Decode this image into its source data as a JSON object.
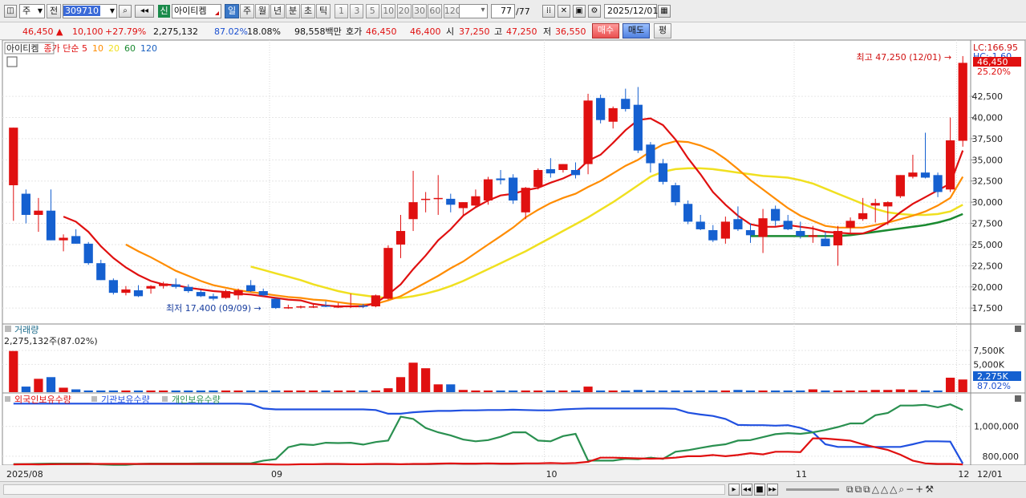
{
  "toolbar": {
    "type_select": "주",
    "prev_label": "전",
    "code": "309710",
    "new_badge": "신",
    "stock_name": "아이티켐",
    "periods": [
      "일",
      "주",
      "월",
      "년",
      "분",
      "초",
      "틱"
    ],
    "active_period": "일",
    "intervals": [
      "1",
      "3",
      "5",
      "10",
      "20",
      "30",
      "60",
      "120"
    ],
    "count": "77",
    "count_total": "/77",
    "date": "2025/12/01"
  },
  "quote": {
    "price": "46,450",
    "change_arrow": "▲",
    "change": "10,100",
    "change_pct": "+27.79%",
    "volume": "2,275,132",
    "vol_ratio": "87.02%",
    "turnover": "18.08%",
    "amount": "98,558백만",
    "bid_label": "호가",
    "ask": "46,450",
    "bid": "46,400",
    "open_label": "시",
    "open": "37,250",
    "high_label": "고",
    "high": "47,250",
    "low_label": "저",
    "low": "36,550",
    "buy_label": "매수",
    "sell_label": "매도",
    "flat_label": "평"
  },
  "price_pane": {
    "legend_name": "아이티켐",
    "legend_ma": "종가 단순",
    "ma_periods": [
      "5",
      "10",
      "20",
      "60",
      "120"
    ],
    "lc": "LC:166.95",
    "hc": "HC:-1.60",
    "current_tag": "46,450",
    "current_pct": "25.20%",
    "high_note": "최고 47,250 (12/01)",
    "low_note": "최저 17,400 (09/09)",
    "y_ticks": [
      "42,500",
      "40,000",
      "37,500",
      "35,000",
      "32,500",
      "30,000",
      "27,500",
      "25,000",
      "22,500",
      "20,000",
      "17,500"
    ]
  },
  "volume_pane": {
    "title": "거래량",
    "value_text": "2,275,132주(87.02%)",
    "y_ticks": [
      "7,500K",
      "5,000K"
    ],
    "current_tag": "2,275K",
    "current_pct": "87.02%"
  },
  "holding_pane": {
    "legend": [
      "외국인보유수량",
      "기관보유수량",
      "개인보유수량"
    ],
    "y_ticks": [
      "1,000,000",
      "800,000"
    ]
  },
  "x_axis": {
    "labels": [
      "2025/08",
      "09",
      "10",
      "11",
      "12"
    ],
    "right_label": "12/01"
  },
  "colors": {
    "up": "#e01010",
    "down": "#1560d0",
    "ma5": "#e01010",
    "ma10": "#ff8c00",
    "ma20": "#f0e020",
    "ma60": "#1a8a30",
    "foreign": "#e01010",
    "institution": "#2050e0",
    "individual": "#2a9050"
  },
  "chart_data": {
    "type": "candlestick",
    "x_start": "2025/08",
    "x_end": "2025/12/01",
    "ylim": [
      16000,
      48000
    ],
    "candles": [
      {
        "o": 32000,
        "h": 38800,
        "l": 27800,
        "c": 38800
      },
      {
        "o": 31000,
        "h": 31500,
        "l": 27500,
        "c": 28500
      },
      {
        "o": 28500,
        "h": 30500,
        "l": 26500,
        "c": 29000
      },
      {
        "o": 29000,
        "h": 31500,
        "l": 25500,
        "c": 25500
      },
      {
        "o": 25500,
        "h": 26200,
        "l": 24200,
        "c": 25800
      },
      {
        "o": 26000,
        "h": 26800,
        "l": 25100,
        "c": 25100
      },
      {
        "o": 25100,
        "h": 25300,
        "l": 22600,
        "c": 22800
      },
      {
        "o": 22800,
        "h": 23200,
        "l": 20800,
        "c": 20800
      },
      {
        "o": 20800,
        "h": 21000,
        "l": 19100,
        "c": 19300
      },
      {
        "o": 19300,
        "h": 20100,
        "l": 19000,
        "c": 19700
      },
      {
        "o": 19600,
        "h": 20200,
        "l": 18800,
        "c": 18900
      },
      {
        "o": 19800,
        "h": 20200,
        "l": 19200,
        "c": 20100
      },
      {
        "o": 20100,
        "h": 20600,
        "l": 19800,
        "c": 20400
      },
      {
        "o": 20300,
        "h": 21000,
        "l": 19800,
        "c": 20000
      },
      {
        "o": 20000,
        "h": 20300,
        "l": 19300,
        "c": 19500
      },
      {
        "o": 19400,
        "h": 19600,
        "l": 18800,
        "c": 18900
      },
      {
        "o": 18900,
        "h": 19200,
        "l": 18400,
        "c": 18600
      },
      {
        "o": 18700,
        "h": 19700,
        "l": 18600,
        "c": 19500
      },
      {
        "o": 19000,
        "h": 19800,
        "l": 18500,
        "c": 19600
      },
      {
        "o": 20200,
        "h": 20800,
        "l": 19400,
        "c": 19500
      },
      {
        "o": 19500,
        "h": 19800,
        "l": 18900,
        "c": 19000
      },
      {
        "o": 18600,
        "h": 18700,
        "l": 17400,
        "c": 17500
      },
      {
        "o": 17500,
        "h": 17900,
        "l": 17400,
        "c": 17600
      },
      {
        "o": 17600,
        "h": 17800,
        "l": 17450,
        "c": 17700
      },
      {
        "o": 17600,
        "h": 18000,
        "l": 17500,
        "c": 17700
      },
      {
        "o": 17800,
        "h": 18300,
        "l": 17600,
        "c": 17700
      },
      {
        "o": 17700,
        "h": 18100,
        "l": 17500,
        "c": 17700
      },
      {
        "o": 17700,
        "h": 19200,
        "l": 17500,
        "c": 17800
      },
      {
        "o": 17800,
        "h": 18000,
        "l": 17500,
        "c": 17700
      },
      {
        "o": 17700,
        "h": 19100,
        "l": 17600,
        "c": 19000
      },
      {
        "o": 18600,
        "h": 24900,
        "l": 18500,
        "c": 24600
      },
      {
        "o": 25000,
        "h": 28500,
        "l": 23400,
        "c": 26600
      },
      {
        "o": 28000,
        "h": 33700,
        "l": 26600,
        "c": 30000
      },
      {
        "o": 30300,
        "h": 31200,
        "l": 28800,
        "c": 30400
      },
      {
        "o": 30400,
        "h": 33200,
        "l": 28500,
        "c": 30500
      },
      {
        "o": 30400,
        "h": 31000,
        "l": 28800,
        "c": 29700
      },
      {
        "o": 29300,
        "h": 30000,
        "l": 28400,
        "c": 30000
      },
      {
        "o": 29600,
        "h": 31500,
        "l": 29400,
        "c": 30700
      },
      {
        "o": 30200,
        "h": 33000,
        "l": 29700,
        "c": 32700
      },
      {
        "o": 32800,
        "h": 33800,
        "l": 32100,
        "c": 32600
      },
      {
        "o": 32900,
        "h": 33300,
        "l": 29800,
        "c": 30200
      },
      {
        "o": 28800,
        "h": 31800,
        "l": 28000,
        "c": 31700
      },
      {
        "o": 31800,
        "h": 34000,
        "l": 31500,
        "c": 33800
      },
      {
        "o": 33900,
        "h": 35200,
        "l": 32900,
        "c": 33400
      },
      {
        "o": 33800,
        "h": 34500,
        "l": 33500,
        "c": 34500
      },
      {
        "o": 33800,
        "h": 34700,
        "l": 32800,
        "c": 33200
      },
      {
        "o": 34500,
        "h": 42800,
        "l": 33300,
        "c": 42000
      },
      {
        "o": 42300,
        "h": 42700,
        "l": 39300,
        "c": 39700
      },
      {
        "o": 39500,
        "h": 41300,
        "l": 38700,
        "c": 41100
      },
      {
        "o": 42200,
        "h": 43400,
        "l": 40700,
        "c": 41000
      },
      {
        "o": 41500,
        "h": 43600,
        "l": 35800,
        "c": 36100
      },
      {
        "o": 36800,
        "h": 37100,
        "l": 33500,
        "c": 34600
      },
      {
        "o": 34600,
        "h": 35100,
        "l": 32100,
        "c": 32400
      },
      {
        "o": 32000,
        "h": 32300,
        "l": 29600,
        "c": 30000
      },
      {
        "o": 29800,
        "h": 30200,
        "l": 27400,
        "c": 27700
      },
      {
        "o": 27700,
        "h": 28500,
        "l": 26700,
        "c": 26800
      },
      {
        "o": 26700,
        "h": 27300,
        "l": 25300,
        "c": 25500
      },
      {
        "o": 25700,
        "h": 28300,
        "l": 25100,
        "c": 27700
      },
      {
        "o": 28000,
        "h": 29500,
        "l": 26600,
        "c": 26800
      },
      {
        "o": 26700,
        "h": 27500,
        "l": 25200,
        "c": 26100
      },
      {
        "o": 25900,
        "h": 29200,
        "l": 24000,
        "c": 28100
      },
      {
        "o": 29200,
        "h": 29600,
        "l": 27200,
        "c": 27800
      },
      {
        "o": 27800,
        "h": 28500,
        "l": 26700,
        "c": 26800
      },
      {
        "o": 26600,
        "h": 27700,
        "l": 25700,
        "c": 26000
      },
      {
        "o": 25900,
        "h": 27200,
        "l": 25200,
        "c": 26100
      },
      {
        "o": 25700,
        "h": 26500,
        "l": 24800,
        "c": 24800
      },
      {
        "o": 24900,
        "h": 27200,
        "l": 22500,
        "c": 26600
      },
      {
        "o": 27000,
        "h": 28200,
        "l": 26400,
        "c": 27800
      },
      {
        "o": 28000,
        "h": 30500,
        "l": 27800,
        "c": 28700
      },
      {
        "o": 29600,
        "h": 30400,
        "l": 27600,
        "c": 29900
      },
      {
        "o": 29500,
        "h": 30100,
        "l": 27300,
        "c": 30000
      },
      {
        "o": 30700,
        "h": 33200,
        "l": 30500,
        "c": 33200
      },
      {
        "o": 33000,
        "h": 35600,
        "l": 32800,
        "c": 33500
      },
      {
        "o": 33500,
        "h": 38200,
        "l": 32800,
        "c": 32900
      },
      {
        "o": 33200,
        "h": 33500,
        "l": 30600,
        "c": 31200
      },
      {
        "o": 31500,
        "h": 40000,
        "l": 31200,
        "c": 37300
      },
      {
        "o": 37250,
        "h": 47250,
        "l": 36550,
        "c": 46450
      }
    ],
    "ma5": [
      null,
      null,
      null,
      null,
      28300,
      27700,
      26500,
      24800,
      23400,
      22300,
      21400,
      20700,
      20300,
      20200,
      19900,
      19700,
      19500,
      19400,
      19200,
      19100,
      18900,
      18700,
      18500,
      18400,
      18000,
      17800,
      17700,
      17700,
      17700,
      18100,
      19100,
      20300,
      22100,
      23700,
      25500,
      26800,
      28400,
      29400,
      30200,
      30800,
      31000,
      31400,
      31700,
      32300,
      32800,
      33500,
      34900,
      35600,
      37000,
      38500,
      39700,
      39900,
      39100,
      37400,
      35200,
      33300,
      31200,
      29700,
      28400,
      27400,
      27100,
      27100,
      27300,
      27100,
      26900,
      26500,
      26400,
      26300,
      26300,
      26800,
      27600,
      28800,
      29800,
      30600,
      31400,
      32200,
      36100
    ],
    "ma10": [
      null,
      null,
      null,
      null,
      null,
      null,
      null,
      null,
      null,
      25000,
      24200,
      23500,
      22700,
      21900,
      21300,
      20700,
      20200,
      19900,
      19600,
      19400,
      19200,
      19000,
      18800,
      18700,
      18500,
      18400,
      18200,
      18000,
      17900,
      18000,
      18400,
      18900,
      19700,
      20500,
      21300,
      22200,
      23000,
      24000,
      25000,
      26000,
      27000,
      28200,
      29100,
      29900,
      30500,
      31000,
      31800,
      32500,
      33400,
      34300,
      35000,
      36000,
      36800,
      37200,
      37100,
      36700,
      36100,
      35100,
      33900,
      32600,
      31500,
      30400,
      29300,
      28400,
      27800,
      27200,
      27000,
      27000,
      27000,
      27300,
      27600,
      28000,
      28400,
      28900,
      29600,
      30500,
      33000
    ],
    "ma20": [
      null,
      null,
      null,
      null,
      null,
      null,
      null,
      null,
      null,
      null,
      null,
      null,
      null,
      null,
      null,
      null,
      null,
      null,
      null,
      22400,
      22000,
      21600,
      21200,
      20800,
      20300,
      19900,
      19500,
      19200,
      19000,
      18800,
      18700,
      18700,
      18900,
      19200,
      19600,
      20100,
      20700,
      21400,
      22100,
      22800,
      23500,
      24200,
      25000,
      25800,
      26600,
      27400,
      28200,
      29100,
      30000,
      31000,
      32000,
      33000,
      33600,
      33900,
      34000,
      34000,
      33900,
      33700,
      33500,
      33300,
      33100,
      33000,
      32900,
      32600,
      32200,
      31600,
      31000,
      30400,
      29800,
      29200,
      28800,
      28600,
      28500,
      28500,
      28600,
      28900,
      29700
    ],
    "ma60": [
      null,
      null,
      null,
      null,
      null,
      null,
      null,
      null,
      null,
      null,
      null,
      null,
      null,
      null,
      null,
      null,
      null,
      null,
      null,
      null,
      null,
      null,
      null,
      null,
      null,
      null,
      null,
      null,
      null,
      null,
      null,
      null,
      null,
      null,
      null,
      null,
      null,
      null,
      null,
      null,
      null,
      null,
      null,
      null,
      null,
      null,
      null,
      null,
      null,
      null,
      null,
      null,
      null,
      null,
      null,
      null,
      null,
      null,
      null,
      26000,
      26000,
      26000,
      26000,
      26000,
      26000,
      26000,
      26000,
      26100,
      26300,
      26500,
      26700,
      26900,
      27100,
      27300,
      27600,
      28000,
      28600
    ],
    "volume": [
      7400,
      1000,
      2400,
      2700,
      800,
      500,
      300,
      300,
      300,
      300,
      300,
      300,
      300,
      300,
      300,
      300,
      300,
      300,
      300,
      300,
      300,
      300,
      300,
      300,
      300,
      300,
      300,
      300,
      300,
      300,
      700,
      2700,
      5300,
      4300,
      1400,
      1400,
      400,
      300,
      300,
      300,
      300,
      300,
      300,
      300,
      300,
      300,
      1000,
      300,
      300,
      300,
      400,
      300,
      300,
      300,
      300,
      300,
      300,
      300,
      400,
      300,
      300,
      300,
      300,
      300,
      500,
      300,
      300,
      300,
      300,
      400,
      400,
      500,
      400,
      300,
      300,
      2600,
      2275
    ],
    "volume_ylim": [
      0,
      8800
    ],
    "foreign": [
      745000,
      746000,
      745000,
      746000,
      747000,
      747000,
      748000,
      748000,
      748000,
      748000,
      748000,
      748000,
      748000,
      748000,
      748000,
      748000,
      748000,
      748000,
      748000,
      748000,
      746000,
      744000,
      744000,
      746000,
      746000,
      748000,
      748000,
      746000,
      746000,
      748000,
      748000,
      746000,
      748000,
      748000,
      750000,
      752000,
      750000,
      750000,
      752000,
      750000,
      750000,
      752000,
      752000,
      754000,
      752000,
      754000,
      762000,
      790000,
      790000,
      788000,
      785000,
      783000,
      785000,
      790000,
      800000,
      800000,
      808000,
      800000,
      808000,
      820000,
      812000,
      830000,
      830000,
      828000,
      920000,
      918000,
      912000,
      905000,
      880000,
      860000,
      842000,
      810000,
      770000,
      752000,
      748000,
      748000,
      745000
    ],
    "institution": [
      1153000,
      1153000,
      1153000,
      1153000,
      1153000,
      1153000,
      1153000,
      1153000,
      1153000,
      1153000,
      1153000,
      1153000,
      1153000,
      1153000,
      1153000,
      1153000,
      1153000,
      1153000,
      1153000,
      1150000,
      1120000,
      1114000,
      1114000,
      1114000,
      1114000,
      1114000,
      1114000,
      1114000,
      1114000,
      1110000,
      1085000,
      1085000,
      1095000,
      1100000,
      1104000,
      1104000,
      1108000,
      1108000,
      1110000,
      1110000,
      1112000,
      1110000,
      1108000,
      1108000,
      1114000,
      1118000,
      1120000,
      1120000,
      1120000,
      1120000,
      1120000,
      1120000,
      1120000,
      1118000,
      1092000,
      1080000,
      1070000,
      1050000,
      1010000,
      1008000,
      1008000,
      1005000,
      1008000,
      990000,
      960000,
      880000,
      862000,
      862000,
      862000,
      862000,
      862000,
      862000,
      880000,
      900000,
      900000,
      898000,
      750000
    ],
    "individual": [
      747000,
      747000,
      749000,
      750000,
      750000,
      750000,
      750000,
      745000,
      742000,
      742000,
      748000,
      750000,
      750000,
      750000,
      750000,
      752000,
      752000,
      752000,
      752000,
      752000,
      770000,
      780000,
      860000,
      880000,
      875000,
      890000,
      888000,
      890000,
      878000,
      895000,
      905000,
      1065000,
      1050000,
      990000,
      960000,
      940000,
      912000,
      900000,
      908000,
      930000,
      960000,
      960000,
      905000,
      900000,
      935000,
      950000,
      770000,
      770000,
      770000,
      782000,
      780000,
      790000,
      782000,
      830000,
      840000,
      855000,
      870000,
      880000,
      905000,
      908000,
      928000,
      948000,
      955000,
      950000,
      960000,
      976000,
      996000,
      1020000,
      1020000,
      1075000,
      1090000,
      1140000,
      1140000,
      1145000,
      1128000,
      1148000,
      1110000
    ],
    "holding_ylim": [
      740000,
      1160000
    ]
  }
}
